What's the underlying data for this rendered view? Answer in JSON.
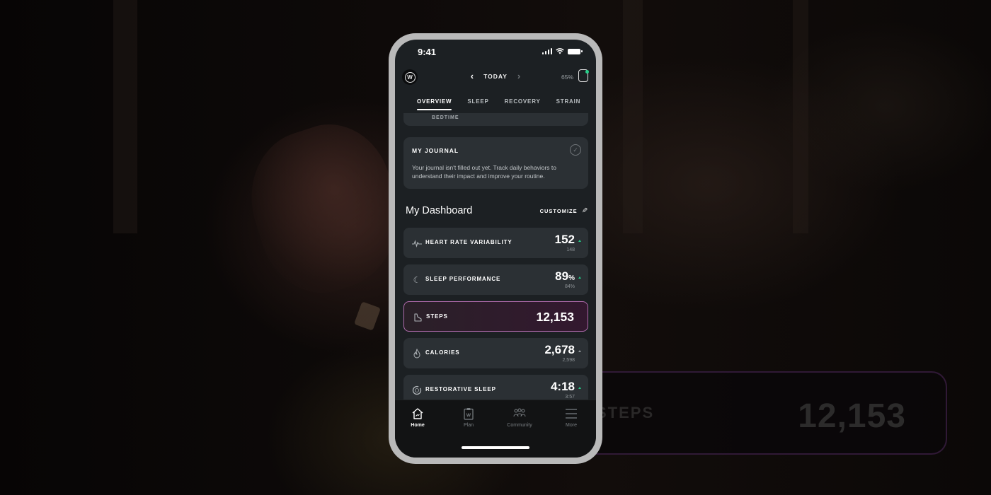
{
  "background": {
    "card_label": "STEPS",
    "card_value": "12,153"
  },
  "status_bar": {
    "time": "9:41"
  },
  "top_nav": {
    "logo": "W",
    "date_label": "TODAY",
    "prev_icon": "chevron-left-icon",
    "next_icon": "chevron-right-icon",
    "battery_percent": "65%"
  },
  "tabs": [
    {
      "label": "OVERVIEW",
      "active": true
    },
    {
      "label": "SLEEP",
      "active": false
    },
    {
      "label": "RECOVERY",
      "active": false
    },
    {
      "label": "STRAIN",
      "active": false
    }
  ],
  "bedtime_card": {
    "label": "BEDTIME"
  },
  "journal": {
    "title": "MY JOURNAL",
    "body": "Your journal isn't filled out yet. Track daily behaviors to understand their impact and improve your routine."
  },
  "dashboard": {
    "title": "My Dashboard",
    "customize_label": "CUSTOMIZE",
    "metrics": [
      {
        "label": "HEART RATE VARIABILITY",
        "value": "152",
        "unit": "",
        "baseline": "148",
        "trend": "up",
        "icon": "heart-rate-variability-icon"
      },
      {
        "label": "SLEEP PERFORMANCE",
        "value": "89",
        "unit": "%",
        "baseline": "84%",
        "trend": "up",
        "icon": "moon-icon"
      },
      {
        "label": "STEPS",
        "value": "12,153",
        "unit": "",
        "baseline": "",
        "trend": "",
        "icon": "shoe-icon",
        "highlighted": true
      },
      {
        "label": "CALORIES",
        "value": "2,678",
        "unit": "",
        "baseline": "2,598",
        "trend": "neutral",
        "icon": "flame-icon"
      },
      {
        "label": "RESTORATIVE SLEEP",
        "value": "4:18",
        "unit": "",
        "baseline": "3:57",
        "trend": "up",
        "icon": "restorative-sleep-icon"
      }
    ]
  },
  "bottom_nav": [
    {
      "label": "Home",
      "icon": "home-icon",
      "active": true
    },
    {
      "label": "Plan",
      "icon": "plan-clipboard-icon",
      "active": false
    },
    {
      "label": "Community",
      "icon": "community-icon",
      "active": false
    },
    {
      "label": "More",
      "icon": "menu-icon",
      "active": false
    }
  ],
  "colors": {
    "accent_green": "#23c785",
    "highlight_border": "#b06bad",
    "card_bg": "#2b3034",
    "screen_bg": "#1c2023"
  }
}
